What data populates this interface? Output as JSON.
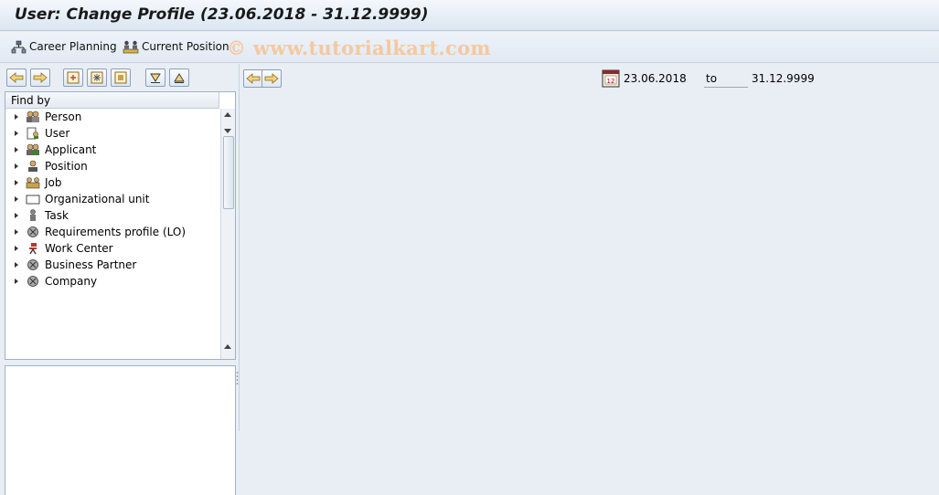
{
  "window": {
    "title": "User: Change Profile (23.06.2018 - 31.12.9999)"
  },
  "appbar": {
    "career_planning": "Career Planning",
    "current_position": "Current Position",
    "watermark": "© www.tutorialkart.com"
  },
  "tree": {
    "header": "Find by",
    "items": [
      {
        "label": "Person",
        "icon": "person-group-icon"
      },
      {
        "label": "User",
        "icon": "user-icon"
      },
      {
        "label": "Applicant",
        "icon": "applicant-icon"
      },
      {
        "label": "Position",
        "icon": "position-icon"
      },
      {
        "label": "Job",
        "icon": "job-icon"
      },
      {
        "label": "Organizational unit",
        "icon": "org-unit-icon"
      },
      {
        "label": "Task",
        "icon": "task-icon"
      },
      {
        "label": "Requirements profile (LO)",
        "icon": "requirements-icon"
      },
      {
        "label": "Work Center",
        "icon": "work-center-icon"
      },
      {
        "label": "Business Partner",
        "icon": "business-partner-icon"
      },
      {
        "label": "Company",
        "icon": "company-icon"
      }
    ]
  },
  "period": {
    "from": "23.06.2018",
    "to_label": "to",
    "to": "31.12.9999"
  }
}
